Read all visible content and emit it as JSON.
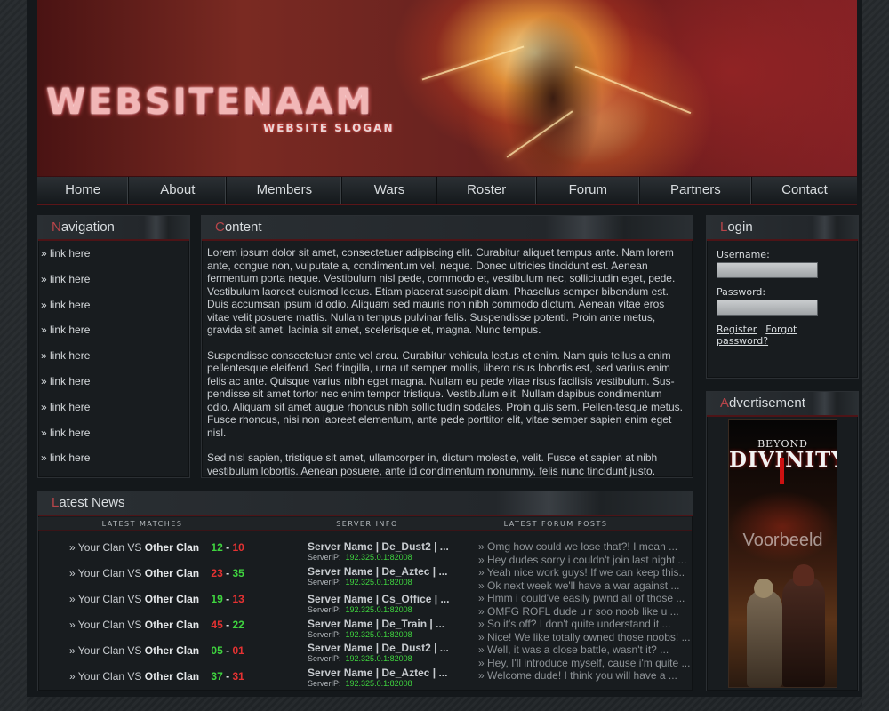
{
  "site": {
    "title": "WEBSITENAAM",
    "slogan": "WEBSITE SLOGAN"
  },
  "menu": [
    "Home",
    "About",
    "Members",
    "Wars",
    "Roster",
    "Forum",
    "Partners",
    "Contact"
  ],
  "navigation": {
    "heading_first": "N",
    "heading_rest": "avigation",
    "links": [
      "» link here",
      "» link here",
      "» link here",
      "» link here",
      "» link here",
      "» link here",
      "» link here",
      "» link here",
      "» link here"
    ]
  },
  "content": {
    "heading_first": "C",
    "heading_rest": "ontent",
    "paragraphs": [
      "Lorem ipsum dolor sit amet, consectetuer adipiscing elit. Curabitur aliquet tempus ante. Nam lorem ante, congue non, vulputate a, condimentum vel, neque. Donec ultricies tincidunt est. Aenean fermentum porta neque. Vestibulum nisl pede, commodo et, vestibulum nec, sollicitudin eget, pede. Vestibulum laoreet euismod lectus. Etiam placerat suscipit diam. Phasellus semper bibendum est. Duis accumsan ipsum id odio. Aliquam sed mauris non nibh commodo dictum. Aenean vitae eros vitae velit posuere mattis. Nullam tempus pulvinar felis. Suspendisse potenti. Proin ante metus, gravida sit amet, lacinia sit amet, scelerisque et, magna. Nunc tempus.",
      "Suspendisse consectetuer ante vel arcu. Curabitur vehicula lectus et enim. Nam quis tellus a enim pellentesque eleifend. Sed fringilla, urna ut semper mollis, libero risus lobortis est, sed varius enim felis ac ante. Quisque varius nibh eget magna. Nullam eu pede vitae risus facilisis vestibulum. Sus-pendisse sit amet tortor nec enim tempor tristique. Vestibulum elit. Nullam dapibus condimentum odio. Aliquam sit amet augue rhoncus nibh sollicitudin sodales. Proin quis sem. Pellen-tesque metus. Fusce rhoncus, nisi non laoreet elementum, ante pede porttitor elit, vitae semper sapien enim eget nisl.",
      "Sed nisl sapien, tristique sit amet, ullamcorper in, dictum molestie, velit. Fusce et sapien at nibh vestibulum lobortis. Aenean posuere, ante id condimentum nonummy, felis nunc tincidunt justo."
    ]
  },
  "login": {
    "heading_first": "L",
    "heading_rest": "ogin",
    "username_label": "Username:",
    "password_label": "Password:",
    "username_value": "",
    "password_value": "",
    "register_label": "Register",
    "forgot_label": "Forgot password?"
  },
  "advertisement": {
    "heading_first": "A",
    "heading_rest": "dvertisement",
    "ad_top": "BEYOND",
    "ad_title": "DIVINITY",
    "watermark": "Voorbeeld"
  },
  "news": {
    "heading_first": "L",
    "heading_rest": "atest News",
    "col_matches": "LATEST MATCHES",
    "col_server": "SERVER INFO",
    "col_posts": "LATEST FORUM POSTS",
    "matches": [
      {
        "prefix": "» Your Clan VS ",
        "opponent": "Other Clan",
        "us": "12",
        "them": "10",
        "result": "win"
      },
      {
        "prefix": "» Your Clan VS ",
        "opponent": "Other Clan",
        "us": "23",
        "them": "35",
        "result": "loss"
      },
      {
        "prefix": "» Your Clan VS ",
        "opponent": "Other Clan",
        "us": "19",
        "them": "13",
        "result": "win"
      },
      {
        "prefix": "» Your Clan VS ",
        "opponent": "Other Clan",
        "us": "45",
        "them": "22",
        "result": "loss"
      },
      {
        "prefix": "» Your Clan VS ",
        "opponent": "Other Clan",
        "us": "05",
        "them": "01",
        "result": "win"
      },
      {
        "prefix": "» Your Clan VS ",
        "opponent": "Other Clan",
        "us": "37",
        "them": "31",
        "result": "win"
      }
    ],
    "servers": [
      {
        "name": "Server Name | De_Dust2 | ...",
        "ip_label": "ServerIP:",
        "ip": "192.325.0.1:82008"
      },
      {
        "name": "Server Name | De_Aztec | ...",
        "ip_label": "ServerIP:",
        "ip": "192.325.0.1:82008"
      },
      {
        "name": "Server Name | Cs_Office | ...",
        "ip_label": "ServerIP:",
        "ip": "192.325.0.1:82008"
      },
      {
        "name": "Server Name | De_Train | ...",
        "ip_label": "ServerIP:",
        "ip": "192.325.0.1:82008"
      },
      {
        "name": "Server Name | De_Dust2 | ...",
        "ip_label": "ServerIP:",
        "ip": "192.325.0.1:82008"
      },
      {
        "name": "Server Name | De_Aztec | ...",
        "ip_label": "ServerIP:",
        "ip": "192.325.0.1:82008"
      }
    ],
    "posts": [
      "» Omg how could we lose that?! I mean ...",
      "» Hey dudes sorry i couldn't join last night ...",
      "» Yeah nice work guys! If we can keep this..",
      "» Ok next week we'll have a war against ...",
      "» Hmm i could've easily pwnd all of those ...",
      "» OMFG ROFL dude u r soo noob like u ...",
      "» So it's off? I don't quite understand it ...",
      "» Nice! We like totally owned those noobs! ...",
      "» Well, it was a close battle, wasn't it? ...",
      "» Hey, I'll introduce myself, cause i'm quite ...",
      "» Welcome dude! I think you will have a ..."
    ]
  },
  "colors": {
    "accent": "#b8454a",
    "win": "#3fd43f",
    "loss": "#e53232",
    "background": "#1d2124"
  }
}
